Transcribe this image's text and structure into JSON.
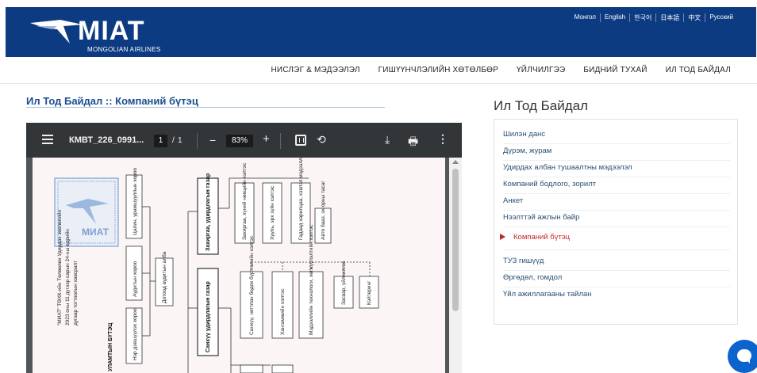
{
  "brand": {
    "name": "MIAT",
    "tagline": "MONGOLIAN AIRLINES"
  },
  "languages": [
    "Монгол",
    "English",
    "한국어",
    "日本語",
    "中文",
    "Русский"
  ],
  "nav": [
    "НИСЛЭГ & МЭДЭЭЛЭЛ",
    "ГИШҮҮНЧЛЭЛИЙН ХӨТӨЛБӨР",
    "ҮЙЛЧИЛГЭЭ",
    "БИДНИЙ ТУХАЙ",
    "ИЛ ТОД БАЙДАЛ"
  ],
  "page_title": "Ил Тод Байдал :: Компаний бүтэц",
  "pdf": {
    "filename": "КМВТ_226_0991...",
    "page_current": "1",
    "page_sep": "/",
    "page_total": "1",
    "zoom": "83%",
    "minus": "−",
    "plus": "+",
    "rotate_icon": "⟲",
    "download_icon": "⤓",
    "print_icon": "🖶",
    "more_icon": "⋮",
    "doc_text": {
      "stamp": "МИАТ",
      "approval_line1": "\"МИАТ\" ТӨХК-ийн Төлөөлөх Удирдах зөвлөлийн",
      "approval_line2": "2023 оны 11 дүгээр сарын 24-ны өдрийн",
      "approval_line3": "дугаар тогтоолын хавсралт",
      "doc_title": "УЛАМТЫН БҮТЭЦ",
      "box_tsalin": "Цалин, урамшууллын хороо",
      "box_audit": "Аудитын хороо",
      "box_nerdevshuulekh": "Нэр дэвшүүлэх хороо",
      "box_dotood": "Дотоод аудитын алба",
      "box_zahirgaa": "Захиргаа, удирдлагын газар",
      "box_sankhuu": "Санхүү удирдлагын газар",
      "box_zahirgaa_heltes": "Захиргаа, хүний нөөцийн хэлтэс",
      "box_huuli": "Хууль, эрх зүйн хэлтэс",
      "box_gadaad": "Гадаад харилцаа, хэвлэл мэдээллийн хэлтэс",
      "box_avto": "Авто бааз, эх орны тасаг",
      "box_sankhuu_tootsoo": "Санхүү, нягтлан бодох бүртгэлийн хэлтэс",
      "box_hanganmj": "Хангамжийн хэлтэс",
      "box_medeelel": "Мэдээллийн технологи, хөгжүүлэлтийн хэлтэс",
      "box_zasvar": "Засвар, үйлчилгээ",
      "box_katering": "Кэйтеринг"
    }
  },
  "sidebar": {
    "title": "Ил Тод Байдал",
    "items": [
      {
        "label": "Шилэн данс",
        "active": false
      },
      {
        "label": "Дүрэм, журам",
        "active": false
      },
      {
        "label": "Удирдах албан тушаалтны мэдээлэл",
        "active": false
      },
      {
        "label": "Компаний бодлого, зорилт",
        "active": false
      },
      {
        "label": "Анкет",
        "active": false
      },
      {
        "label": "Нээлттэй ажлын байр",
        "active": false
      },
      {
        "label": "Компаний бүтэц",
        "active": true
      },
      {
        "label": "ТУЗ гишүүд",
        "active": false
      },
      {
        "label": "Өргөдөл, гомдол",
        "active": false
      },
      {
        "label": "Үйл ажиллагааны тайлан",
        "active": false
      }
    ]
  },
  "colors": {
    "brand_blue": "#0d3b82",
    "link_blue": "#1a4f8e",
    "active_red": "#c62828",
    "chat_blue": "#0b63ce"
  }
}
